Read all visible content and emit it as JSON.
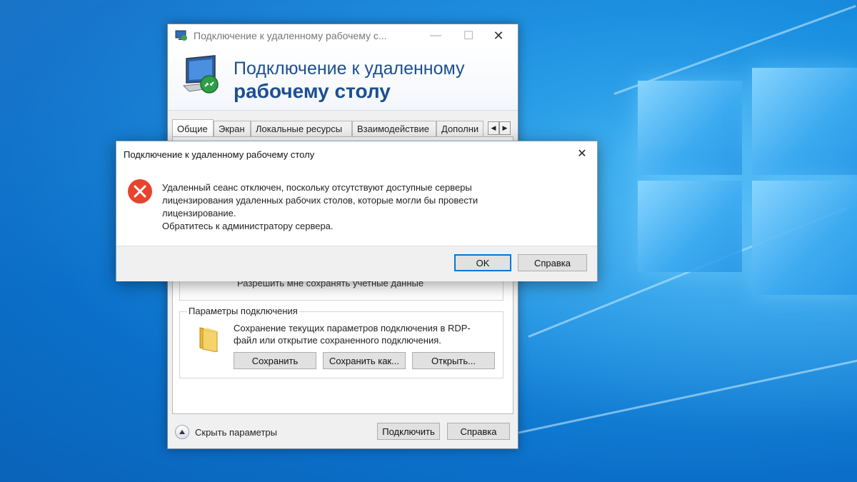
{
  "main_window": {
    "title": "Подключение к удаленному рабочему с...",
    "header_line1": "Подключение к удаленному",
    "header_line2": "рабочему столу",
    "tabs": [
      {
        "label": "Общие"
      },
      {
        "label": "Экран"
      },
      {
        "label": "Локальные ресурсы"
      },
      {
        "label": "Взаимодействие"
      },
      {
        "label": "Дополни"
      }
    ],
    "obscured_text": "Разрешить мне сохранять учетные данные",
    "connection_group": {
      "title": "Параметры подключения",
      "description": "Сохранение текущих параметров подключения в RDP-файл или открытие сохраненного подключения.",
      "save_label": "Сохранить",
      "save_as_label": "Сохранить как...",
      "open_label": "Открыть..."
    },
    "hide_params_label": "Скрыть параметры",
    "connect_label": "Подключить",
    "help_label": "Справка"
  },
  "dialog": {
    "title": "Подключение к удаленному рабочему столу",
    "message_lines": [
      "Удаленный сеанс отключен, поскольку отсутствуют доступные серверы",
      "лицензирования удаленных рабочих столов, которые могли бы провести",
      "лицензирование.",
      "Обратитесь к администратору сервера."
    ],
    "ok_label": "OK",
    "help_label": "Справка"
  },
  "icons": {
    "error": "error-icon",
    "close": "close-icon",
    "folder": "folder-icon",
    "rdp": "remote-desktop-icon",
    "collapse": "chevron-up-icon"
  },
  "colors": {
    "accent": "#0078d7",
    "header_text": "#1c4f91",
    "error_red": "#e8432d"
  }
}
